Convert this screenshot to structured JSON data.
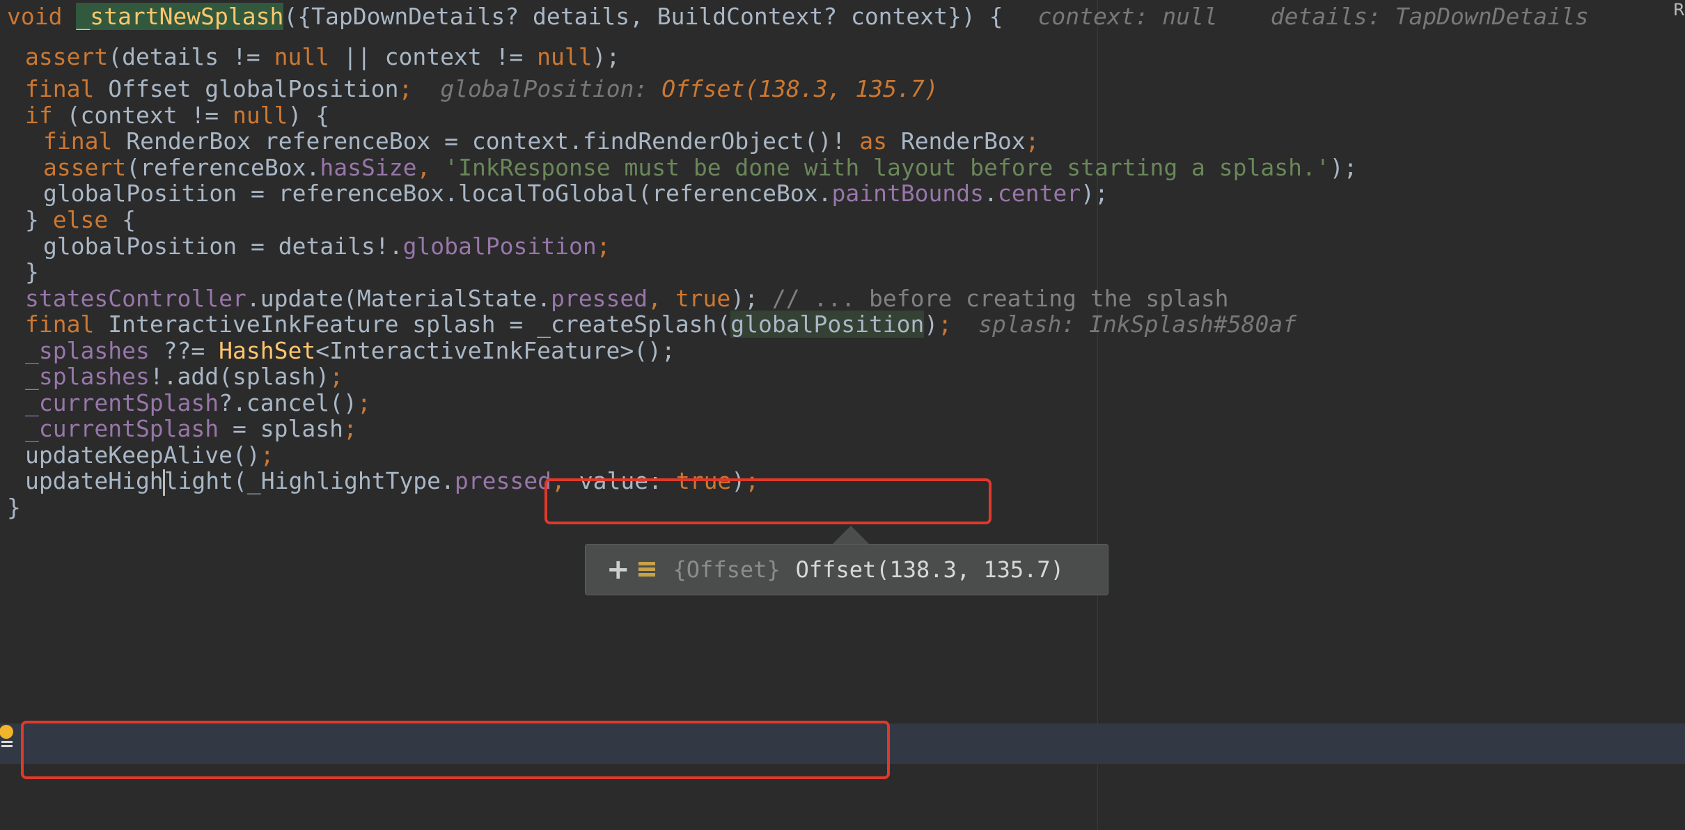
{
  "editor": {
    "corner_label": "R",
    "lines": {
      "l1": {
        "kw_void": "void",
        "fn_name": "_startNewSplash",
        "params": "({TapDownDetails? details, BuildContext? context}) {",
        "hint1": "context: null",
        "hint2": "details: TapDownDetails"
      },
      "l2": {
        "kw": "assert",
        "a": "(details != ",
        "null1": "null",
        "b": " || context != ",
        "null2": "null",
        "c": ");"
      },
      "l4": {
        "kw": "final",
        "a": " Offset globalPosition",
        "semi": ";",
        "hint_label": "globalPosition: ",
        "hint_value": "Offset(138.3, 135.7)"
      },
      "l5": {
        "kw": "if",
        "a": " (context != ",
        "null": "null",
        "b": ") {"
      },
      "l6": {
        "kw": "final",
        "a": " RenderBox referenceBox = context.findRenderObject()! ",
        "kw_as": "as",
        "b": " RenderBox",
        "semi": ";"
      },
      "l7": {
        "kw": "assert",
        "a": "(referenceBox.",
        "field": "hasSize",
        "comma": ", ",
        "str": "'InkResponse must be done with layout before starting a splash.'",
        "b": ");"
      },
      "l8": {
        "a": "globalPosition = referenceBox.localToGlobal(referenceBox.",
        "f1": "paintBounds",
        "dot": ".",
        "f2": "center",
        "b": ");"
      },
      "l9": {
        "a": "} ",
        "kw": "else",
        "b": " {"
      },
      "l10": {
        "a": "globalPosition = details!.",
        "field": "globalPosition",
        "semi": ";"
      },
      "l11": {
        "a": "}"
      },
      "l12": {
        "f1": "statesController",
        "a": ".update(MaterialState.",
        "f2": "pressed",
        "comma": ", ",
        "kw": "true",
        "b": ");",
        "cmt": " // ... before creating the splash"
      },
      "l13": {
        "kw": "final",
        "a": " InteractiveInkFeature splash = ",
        "call": "_createSplash(",
        "arg": "globalPosition",
        "b": ")",
        "semi": ";",
        "hint": "splash: InkSplash#580af"
      },
      "l14": {
        "f1": "_splashes",
        "a": " ??= ",
        "cls": "HashSet",
        "b": "<InteractiveInkFeature>();"
      },
      "l15": {
        "f1": "_splashes",
        "a": "!.add(splash)",
        "semi": ";"
      },
      "l16": {
        "f1": "_currentSplash",
        "a": "?.cancel()",
        "semi": ";"
      },
      "l17": {
        "f1": "_currentSplash",
        "a": " = splash",
        "semi": ";"
      },
      "l18": {
        "a": "updateKeepAlive()",
        "semi": ";"
      },
      "l19": {
        "a1": "updateHigh",
        "a2": "light(_HighlightType.",
        "field": "pressed",
        "comma": ", ",
        "b": "value: ",
        "kw": "true",
        "c": ")",
        "semi": ";"
      },
      "l20": {
        "a": "}"
      }
    }
  },
  "tooltip": {
    "plus": "+",
    "type_label": "{Offset}",
    "value": "Offset(138.3, 135.7)"
  },
  "colors": {
    "background": "#2b2b2b",
    "keyword": "#cc7832",
    "string": "#6a8759",
    "field": "#9876aa",
    "function": "#ffc66d",
    "highlight_box": "#e0392b"
  }
}
